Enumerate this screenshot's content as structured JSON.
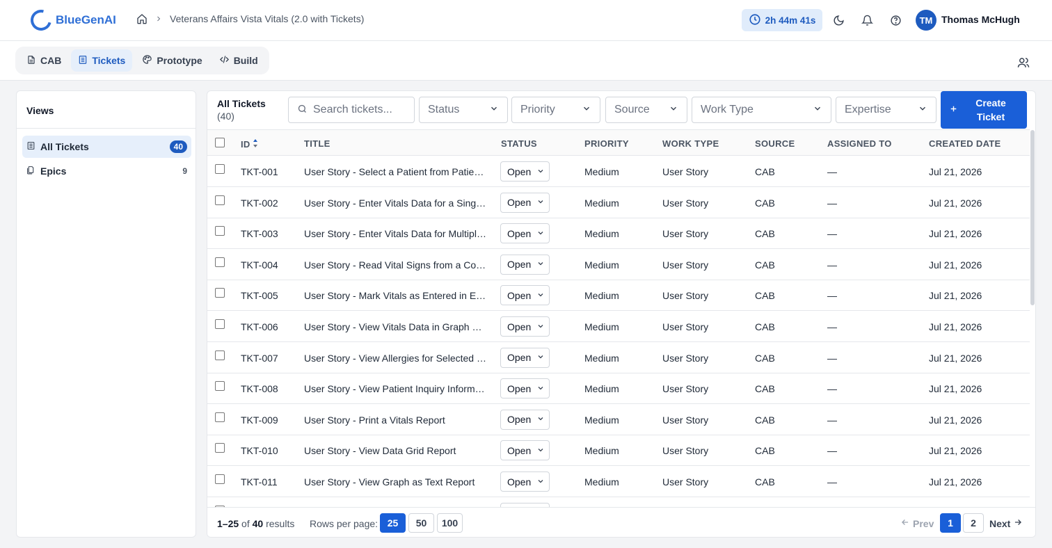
{
  "app": {
    "name": "BlueGenAI",
    "accent": "#1a5fd8"
  },
  "breadcrumb": {
    "project": "Veterans Affairs Vista Vitals (2.0 with Tickets)"
  },
  "header": {
    "timer": "2h 44m 41s",
    "user_initials": "TM",
    "user_name": "Thomas McHugh"
  },
  "tabs": [
    {
      "label": "CAB",
      "icon": "document-icon"
    },
    {
      "label": "Tickets",
      "icon": "list-icon"
    },
    {
      "label": "Prototype",
      "icon": "palette-icon"
    },
    {
      "label": "Build",
      "icon": "code-icon"
    }
  ],
  "sidebar": {
    "title": "Views",
    "items": [
      {
        "label": "All Tickets",
        "count": "40"
      },
      {
        "label": "Epics",
        "count": "9"
      }
    ]
  },
  "toolbar": {
    "title": "All Tickets",
    "count": "(40)",
    "search_placeholder": "Search tickets...",
    "filters": [
      "Status",
      "Priority",
      "Source",
      "Work Type",
      "Expertise"
    ],
    "create_label": "Create Ticket"
  },
  "table": {
    "columns": [
      "ID",
      "TITLE",
      "STATUS",
      "PRIORITY",
      "WORK TYPE",
      "SOURCE",
      "ASSIGNED TO",
      "CREATED DATE"
    ],
    "rows": [
      {
        "id": "TKT-001",
        "title": "User Story - Select a Patient from Patient Lookup",
        "status": "Open",
        "priority": "Medium",
        "work_type": "User Story",
        "source": "CAB",
        "assigned": "—",
        "created": "Jul 21, 2026"
      },
      {
        "id": "TKT-002",
        "title": "User Story - Enter Vitals Data for a Single Patient",
        "status": "Open",
        "priority": "Medium",
        "work_type": "User Story",
        "source": "CAB",
        "assigned": "—",
        "created": "Jul 21, 2026"
      },
      {
        "id": "TKT-003",
        "title": "User Story - Enter Vitals Data for Multiple Patients",
        "status": "Open",
        "priority": "Medium",
        "work_type": "User Story",
        "source": "CAB",
        "assigned": "—",
        "created": "Jul 21, 2026"
      },
      {
        "id": "TKT-004",
        "title": "User Story - Read Vital Signs from a Connected Device",
        "status": "Open",
        "priority": "Medium",
        "work_type": "User Story",
        "source": "CAB",
        "assigned": "—",
        "created": "Jul 21, 2026"
      },
      {
        "id": "TKT-005",
        "title": "User Story - Mark Vitals as Entered in Error",
        "status": "Open",
        "priority": "Medium",
        "work_type": "User Story",
        "source": "CAB",
        "assigned": "—",
        "created": "Jul 21, 2026"
      },
      {
        "id": "TKT-006",
        "title": "User Story - View Vitals Data in Graph and Grid",
        "status": "Open",
        "priority": "Medium",
        "work_type": "User Story",
        "source": "CAB",
        "assigned": "—",
        "created": "Jul 21, 2026"
      },
      {
        "id": "TKT-007",
        "title": "User Story - View Allergies for Selected Patient",
        "status": "Open",
        "priority": "Medium",
        "work_type": "User Story",
        "source": "CAB",
        "assigned": "—",
        "created": "Jul 21, 2026"
      },
      {
        "id": "TKT-008",
        "title": "User Story - View Patient Inquiry Information",
        "status": "Open",
        "priority": "Medium",
        "work_type": "User Story",
        "source": "CAB",
        "assigned": "—",
        "created": "Jul 21, 2026"
      },
      {
        "id": "TKT-009",
        "title": "User Story - Print a Vitals Report",
        "status": "Open",
        "priority": "Medium",
        "work_type": "User Story",
        "source": "CAB",
        "assigned": "—",
        "created": "Jul 21, 2026"
      },
      {
        "id": "TKT-010",
        "title": "User Story - View Data Grid Report",
        "status": "Open",
        "priority": "Medium",
        "work_type": "User Story",
        "source": "CAB",
        "assigned": "—",
        "created": "Jul 21, 2026"
      },
      {
        "id": "TKT-011",
        "title": "User Story - View Graph as Text Report",
        "status": "Open",
        "priority": "Medium",
        "work_type": "User Story",
        "source": "CAB",
        "assigned": "—",
        "created": "Jul 21, 2026"
      },
      {
        "id": "",
        "title": "",
        "status": "",
        "priority": "",
        "work_type": "",
        "source": "",
        "assigned": "",
        "created": ""
      }
    ]
  },
  "pagination": {
    "range": "1–25",
    "of_label": "of",
    "total": "40",
    "results_label": "results",
    "rows_per_page_label": "Rows per page:",
    "rows_per_page_options": [
      "25",
      "50",
      "100"
    ],
    "prev_label": "Prev",
    "next_label": "Next",
    "pages": [
      "1",
      "2"
    ]
  }
}
